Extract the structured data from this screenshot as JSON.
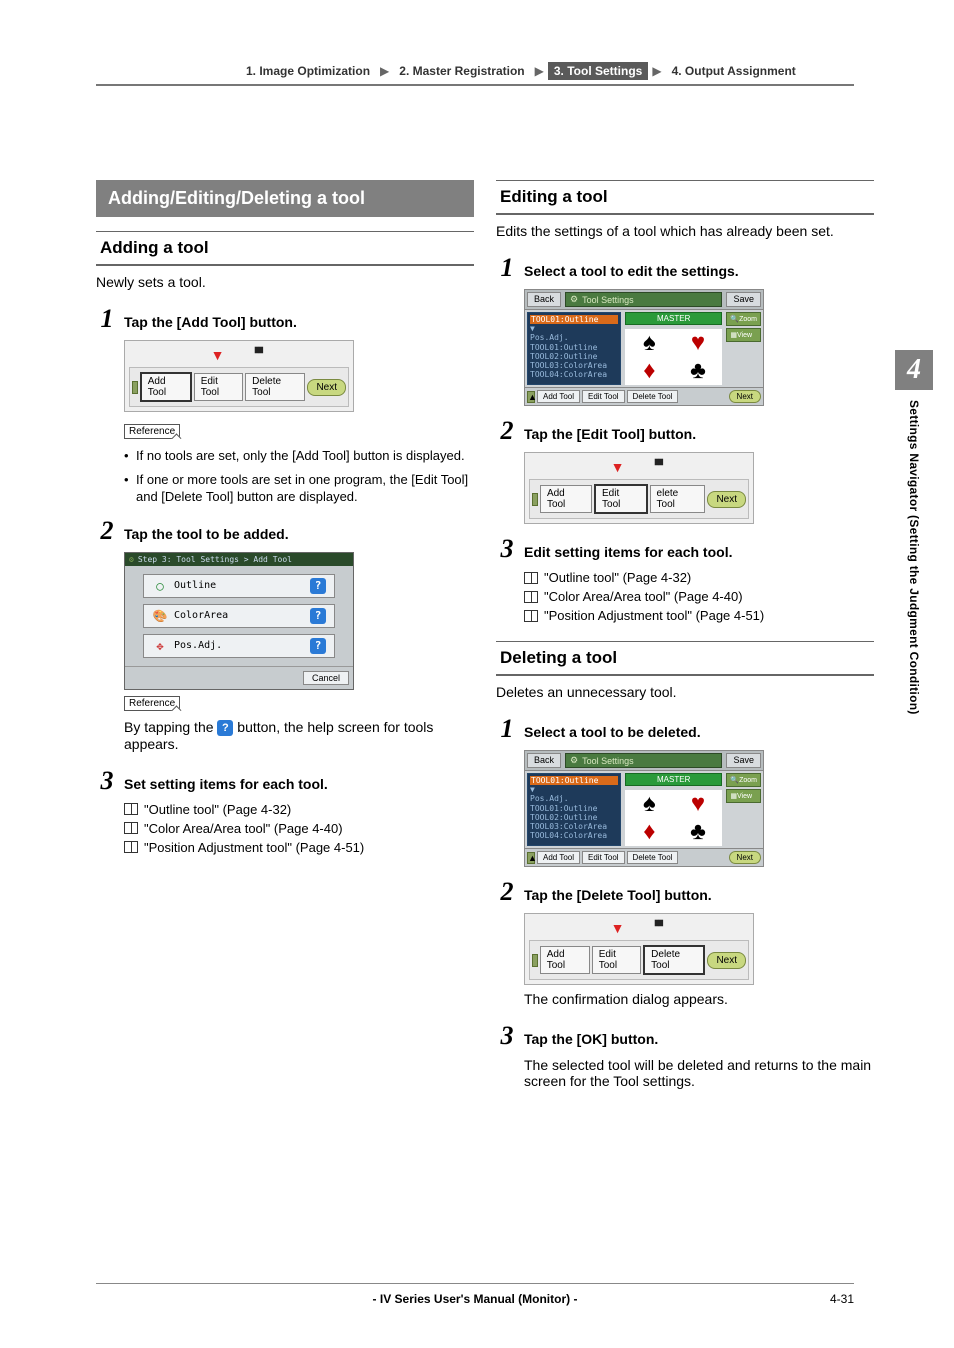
{
  "crumbs": {
    "c1": "1. Image Optimization",
    "c2": "2. Master Registration",
    "c3": "3. Tool Settings",
    "c4": "4. Output Assignment"
  },
  "left": {
    "heading": "Adding/Editing/Deleting a tool",
    "adding": {
      "title": "Adding a tool",
      "intro": "Newly sets a tool.",
      "step1": "Tap the [Add Tool] button.",
      "rowbtns": {
        "add": "Add Tool",
        "edit": "Edit Tool",
        "del": "Delete Tool",
        "next": "Next"
      },
      "reference": "Reference",
      "bullets": [
        "If no tools are set, only the [Add Tool] button is displayed.",
        "If one or more tools are set in one program, the [Edit Tool] and [Delete Tool] button are displayed."
      ],
      "step2": "Tap the tool to be added.",
      "addshot": {
        "header": "Step 3: Tool Settings > Add Tool",
        "opt1": "Outline",
        "opt2": "ColorArea",
        "opt3": "Pos.Adj.",
        "cancel": "Cancel"
      },
      "helpline_a": "By tapping the ",
      "helpline_b": " button, the help screen for tools appears.",
      "step3": "Set setting items for each tool.",
      "refs": [
        "\"Outline tool\" (Page 4-32)",
        "\"Color Area/Area tool\" (Page 4-40)",
        "\"Position Adjustment tool\" (Page 4-51)"
      ]
    }
  },
  "right": {
    "editing": {
      "title": "Editing a tool",
      "intro": "Edits the settings of a tool which has already been set.",
      "step1": "Select a tool to edit the settings.",
      "tsshot": {
        "back": "Back",
        "title": "Tool Settings",
        "save": "Save",
        "master": "MASTER",
        "dd_sel": "TOOL01:Outline",
        "dd_items": [
          "Pos.Adj.",
          "TOOL01:Outline",
          "TOOL02:Outline",
          "TOOL03:ColorArea",
          "TOOL04:ColorArea"
        ],
        "zoom": "Zoom",
        "view": "View",
        "add": "Add Tool",
        "edit": "Edit Tool",
        "del": "Delete Tool",
        "next": "Next"
      },
      "step2": "Tap the [Edit Tool] button.",
      "rowbtns": {
        "add": "Add Tool",
        "edit": "Edit Tool",
        "del": "elete Tool",
        "next": "Next"
      },
      "step3": "Edit setting items for each tool.",
      "refs": [
        "\"Outline tool\" (Page 4-32)",
        "\"Color Area/Area tool\" (Page 4-40)",
        "\"Position Adjustment tool\" (Page 4-51)"
      ]
    },
    "deleting": {
      "title": "Deleting a tool",
      "intro": "Deletes an unnecessary tool.",
      "step1": "Select a tool to be deleted.",
      "step2": "Tap the [Delete Tool] button.",
      "rowbtns": {
        "add": "Add Tool",
        "edit": "Edit Tool",
        "del": "Delete Tool",
        "next": "Next"
      },
      "confirm": "The confirmation dialog appears.",
      "step3": "Tap the [OK] button.",
      "outcome": "The selected tool will be deleted and returns to the main screen for the Tool settings."
    }
  },
  "sidetab": {
    "num": "4",
    "text": "Settings Navigator (Setting the Judgment Condition)"
  },
  "footer": {
    "mid": "- IV Series User's Manual (Monitor) -",
    "page": "4-31"
  }
}
